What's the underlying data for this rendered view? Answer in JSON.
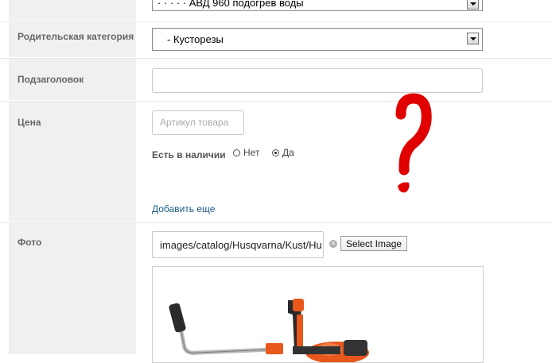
{
  "form": {
    "top_select": {
      "value": "· · · · ·  АВД 960 подогрев воды"
    },
    "parent_category": {
      "label": "Родительская категория",
      "value": "- Кусторезы"
    },
    "subtitle": {
      "label": "Подзаголовок",
      "value": ""
    },
    "price": {
      "label": "Цена",
      "article_placeholder": "Артикул товара",
      "availability_label": "Есть в наличии",
      "option_no": "Нет",
      "option_yes": "Да",
      "selected": "Да",
      "add_more_link": "Добавить еще"
    },
    "photo": {
      "label": "Фото",
      "path_value": "images/catalog/Husqvarna/Kust/Hu",
      "select_button": "Select Image"
    }
  },
  "annotation": {
    "mark": "?",
    "color": "#e00000"
  },
  "colors": {
    "label_bg": "#f0f0f0",
    "link": "#1a5b8a",
    "product_orange": "#e8571c"
  }
}
